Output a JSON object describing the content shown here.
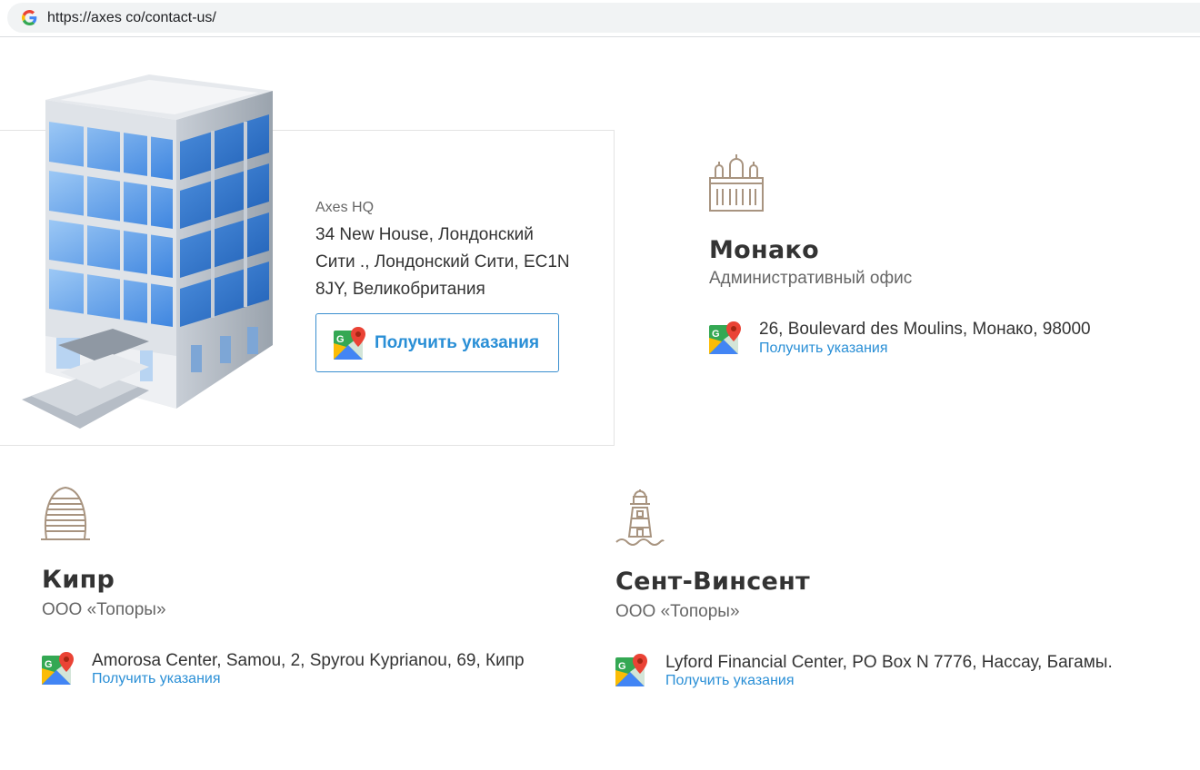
{
  "browser": {
    "url": "https://axes co/contact-us/",
    "favicon": "google-g-icon"
  },
  "hq": {
    "name": "Axes HQ",
    "address": "34 New House, Лондонский Сити ., Лондонский Сити, EC1N 8JY, Великобритания",
    "button_label": "Получить указания",
    "image": "office-building-illustration"
  },
  "offices": {
    "monaco": {
      "emblem": "palace-icon",
      "title": "Монако",
      "subtitle": "Административный офис",
      "address": "26, Boulevard des Moulins, Монако, 98000",
      "link": "Получить указания"
    },
    "cyprus": {
      "emblem": "tower-icon",
      "title": "Кипр",
      "subtitle": "ООО «Топоры»",
      "address": "Amorosa Center, Samou, 2, Spyrou Kyprianou, 69, Кипр",
      "link": "Получить указания"
    },
    "st_vincent": {
      "emblem": "lighthouse-icon",
      "title": "Сент-Винсент",
      "subtitle": "ООО «Топоры»",
      "address": "Lyford Financial Center, PO Box N 7776, Нассау, Багамы.",
      "link": "Получить указания"
    }
  },
  "colors": {
    "link": "#2a8fd6",
    "emblem": "#a89480",
    "card_border": "#e3e3e3"
  }
}
